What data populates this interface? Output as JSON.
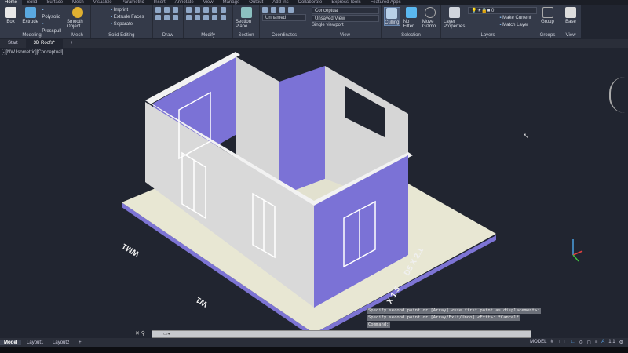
{
  "menu_tabs": [
    "Home",
    "Solid",
    "Surface",
    "Mesh",
    "Visualize",
    "Parametric",
    "Insert",
    "Annotate",
    "View",
    "Manage",
    "Output",
    "Add-ins",
    "Collaborate",
    "Express Tools",
    "Featured Apps"
  ],
  "ribbon": {
    "modeling": {
      "title": "Modeling",
      "box": "Box",
      "extrude": "Extrude",
      "polysolid": "Polysolid",
      "presspull": "Presspull"
    },
    "mesh": {
      "title": "Mesh",
      "smooth": "Smooth Object"
    },
    "solid_editing": {
      "title": "Solid Editing",
      "imprint": "Imprint",
      "extrude_faces": "Extrude Faces",
      "separate": "Separate"
    },
    "draw": {
      "title": "Draw"
    },
    "modify": {
      "title": "Modify"
    },
    "section": {
      "title": "Section",
      "plane": "Section Plane"
    },
    "coordinates": {
      "title": "Coordinates",
      "ucs": "Unnamed"
    },
    "view": {
      "title": "View",
      "visual_style": "Conceptual",
      "saved_view": "Unsaved View",
      "viewport": "Single viewport"
    },
    "selection": {
      "title": "Selection",
      "culling": "Culling",
      "no_filter": "No Filter",
      "move_gizmo": "Move Gizmo"
    },
    "layers": {
      "title": "Layers",
      "properties": "Layer Properties",
      "current_layer": "0",
      "make_current": "Make Current",
      "match_layer": "Match Layer"
    },
    "groups": {
      "title": "Groups",
      "group": "Group"
    },
    "view2": {
      "title": "View",
      "base": "Base"
    }
  },
  "doc_tabs": [
    "Start",
    "3D Roofs*"
  ],
  "viewport_label": "[-][NW Isometric][Conceptual]",
  "drawing_labels": {
    "wm1": "WM1",
    "w1": "W1",
    "d5": "D5 X 2.1",
    "x15": "X 1.5"
  },
  "command": {
    "history": [
      "Specify second point or [Array] <use first point as displacement>:",
      "Specify second point or [Array/Exit/Undo] <Exit>: *Cancel*",
      "Command:"
    ],
    "placeholder": ""
  },
  "layout_tabs": [
    "Model",
    "Layout1",
    "Layout2",
    "+"
  ],
  "status": {
    "model": "MODEL",
    "scale": "1:1"
  },
  "colors": {
    "purple_wall": "#7b72d6",
    "grey_wall": "#d9d9d9",
    "base": "#e8e7d3"
  }
}
